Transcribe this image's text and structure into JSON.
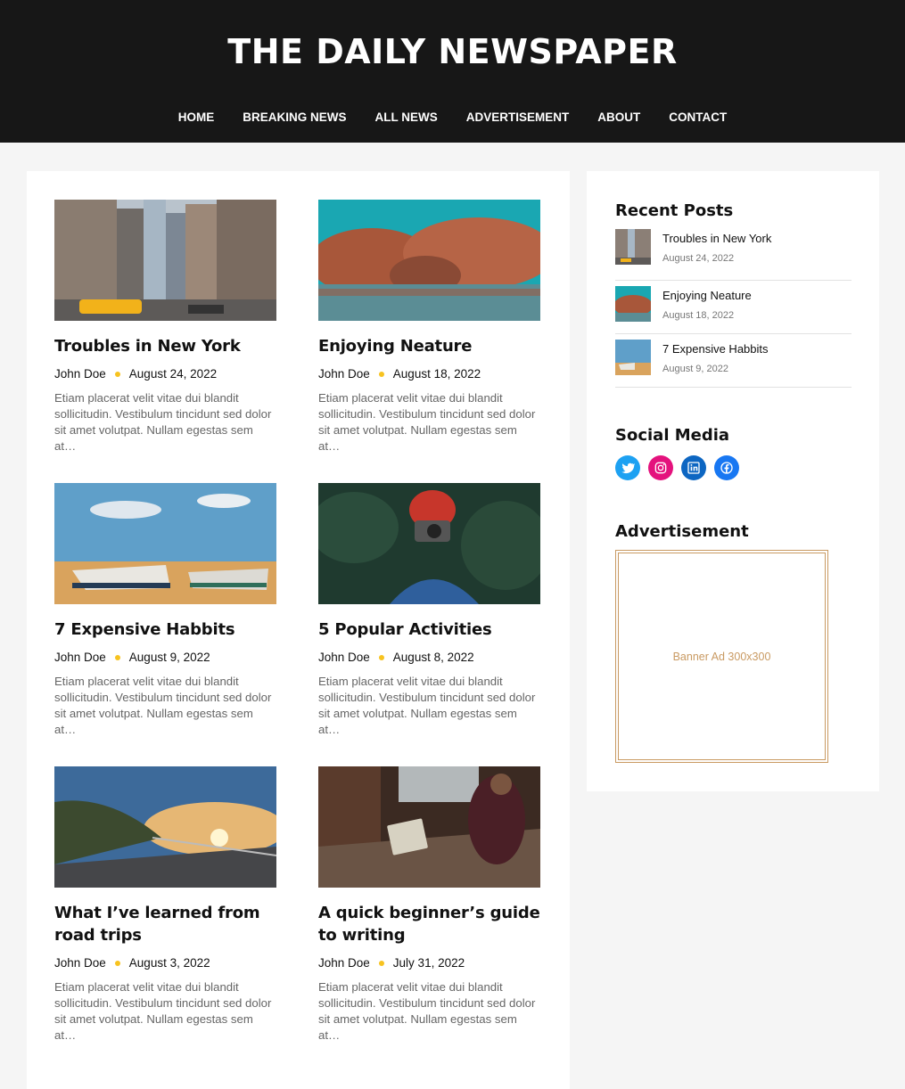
{
  "site": {
    "title": "THE DAILY NEWSPAPER"
  },
  "nav": [
    "HOME",
    "BREAKING NEWS",
    "ALL NEWS",
    "ADVERTISEMENT",
    "ABOUT",
    "CONTACT"
  ],
  "posts": [
    {
      "title": "Troubles in New York",
      "author": "John Doe",
      "date": "August 24, 2022",
      "excerpt": "Etiam placerat velit vitae dui blandit sollicitudin. Vestibulum tincidunt sed dolor sit amet volutpat. Nullam egestas sem at…"
    },
    {
      "title": "Enjoying Neature",
      "author": "John Doe",
      "date": "August 18, 2022",
      "excerpt": "Etiam placerat velit vitae dui blandit sollicitudin. Vestibulum tincidunt sed dolor sit amet volutpat. Nullam egestas sem at…"
    },
    {
      "title": "7 Expensive Habbits",
      "author": "John Doe",
      "date": "August 9, 2022",
      "excerpt": "Etiam placerat velit vitae dui blandit sollicitudin. Vestibulum tincidunt sed dolor sit amet volutpat. Nullam egestas sem at…"
    },
    {
      "title": "5 Popular Activities",
      "author": "John Doe",
      "date": "August 8, 2022",
      "excerpt": "Etiam placerat velit vitae dui blandit sollicitudin. Vestibulum tincidunt sed dolor sit amet volutpat. Nullam egestas sem at…"
    },
    {
      "title": "What I’ve learned from road trips",
      "author": "John Doe",
      "date": "August 3, 2022",
      "excerpt": "Etiam placerat velit vitae dui blandit sollicitudin. Vestibulum tincidunt sed dolor sit amet volutpat. Nullam egestas sem at…"
    },
    {
      "title": "A quick beginner’s guide to writing",
      "author": "John Doe",
      "date": "July 31, 2022",
      "excerpt": "Etiam placerat velit vitae dui blandit sollicitudin. Vestibulum tincidunt sed dolor sit amet volutpat. Nullam egestas sem at…"
    }
  ],
  "sidebar": {
    "recent_title": "Recent Posts",
    "recent": [
      {
        "title": "Troubles in New York",
        "date": "August 24, 2022"
      },
      {
        "title": "Enjoying Neature",
        "date": "August 18, 2022"
      },
      {
        "title": "7 Expensive Habbits",
        "date": "August 9, 2022"
      }
    ],
    "social_title": "Social Media",
    "social": [
      {
        "icon": "twitter-icon",
        "color": "#1da1f2"
      },
      {
        "icon": "instagram-icon",
        "color": "#e4127d"
      },
      {
        "icon": "linkedin-icon",
        "color": "#0d66c2"
      },
      {
        "icon": "facebook-icon",
        "color": "#1877f2"
      }
    ],
    "ad_title": "Advertisement",
    "ad_text": "Banner Ad 300x300"
  },
  "colors": {
    "header_bg": "#171717",
    "meta_dot": "#f7c320",
    "ad_border": "#c99a62"
  }
}
